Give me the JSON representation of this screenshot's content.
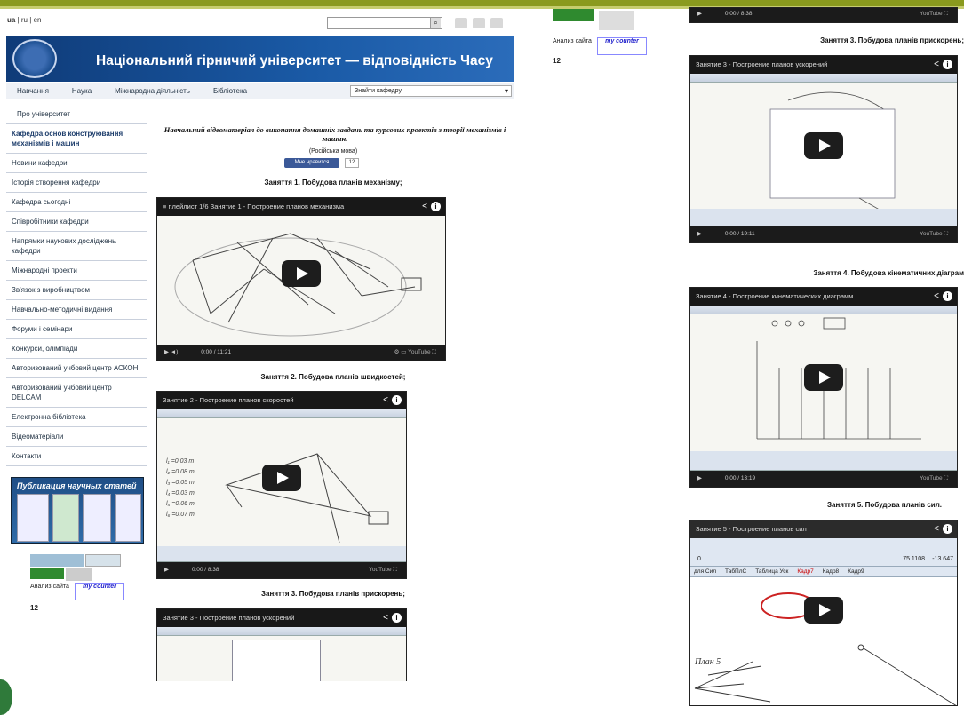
{
  "header": {
    "lang_links": [
      "ua",
      "ru",
      "en"
    ],
    "lang_sep": "|",
    "site_title": "Національний гірничий університет — відповідність Часу"
  },
  "nav": {
    "items": [
      "Навчання",
      "Наука",
      "Міжнародна діяльність",
      "Бібліотека"
    ],
    "dept_select": "Знайти кафедру"
  },
  "sidebar": {
    "items": [
      "Про університет",
      "Кафедра основ конструювання механізмів і машин",
      "Новини кафедри",
      "Історія створення кафедри",
      "Кафедра сьогодні",
      "Співробітники кафедри",
      "Напрямки наукових досліджень кафедри",
      "Міжнародні проекти",
      "Зв'язок з виробництвом",
      "Навчально-методичні видання",
      "Форуми і семінари",
      "Конкурси, олімпіади",
      "Авторизований учбовий центр АСКОН",
      "Авторизований учбовий центр DELCAM",
      "Електронна бібліотека",
      "Відеоматеріали",
      "Контакти"
    ],
    "pub_banner": "Публикация научных статей"
  },
  "counters": {
    "site_analysis": "Анализ сайта",
    "my_counter": "my counter",
    "tic": "12"
  },
  "main": {
    "intro": "Навчальний відеоматеріал до виконання домашніх завдань та курсових проектів з теорії механізмів і машин.",
    "lang_note": "(Російська мова)",
    "like_label": "Мне нравится",
    "like_count": "12",
    "lessons": [
      "Заняття 1. Побудова планів механізму;",
      "Заняття 2. Побудова планів швидкостей;",
      "Заняття 3. Побудова планів прискорень;"
    ],
    "videos": [
      {
        "title": "Занятие 1 - Построение планов механизма",
        "playlist": "плейлист",
        "counter": "1/6",
        "time": "0:00 / 11:21"
      },
      {
        "title": "Занятие 2 - Построение планов скоростей",
        "time": "0:00 / 8:38"
      },
      {
        "title": "Занятие 3 - Построение планов ускорений"
      }
    ]
  },
  "right": {
    "top_video_time": "0:00 / 8:38",
    "lessons": [
      "Заняття 3. Побудова планів прискорень;",
      "Заняття 4. Побудова кінематичних діаграм",
      "Заняття 5. Побудова планів сил."
    ],
    "videos": [
      {
        "title": "Занятие 3 - Построение планов ускорений",
        "time": "0:00 / 19:11"
      },
      {
        "title": "Занятие 4 - Построение кинематических диаграмм",
        "time": "0:00 / 13:19"
      },
      {
        "title": "Занятие 5 - Построение планов сил"
      }
    ],
    "ppt_tabs": [
      "для Сил",
      "ТабПлС",
      "Таблица Уск",
      "Кадр7",
      "Кадр8",
      "Кадр9"
    ],
    "ppt_fields": [
      "0",
      "75.1108",
      "-13.647"
    ],
    "plan_label": "План 5"
  }
}
